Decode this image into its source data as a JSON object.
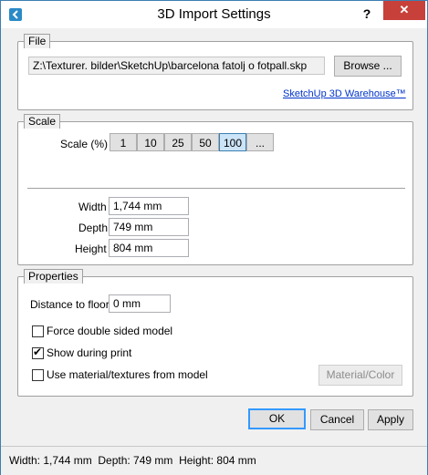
{
  "window": {
    "title": "3D Import Settings",
    "help_label": "?",
    "close_label": "✕"
  },
  "file_group": {
    "legend": "File",
    "path": "Z:\\Texturer. bilder\\SketchUp\\barcelona fatolj o fotpall.skp",
    "browse_label": "Browse ...",
    "warehouse_link": "SketchUp 3D Warehouse™"
  },
  "scale_group": {
    "legend": "Scale",
    "scale_label": "Scale (%)",
    "options": [
      "1",
      "10",
      "25",
      "50",
      "100",
      "..."
    ],
    "selected": "100",
    "width_label": "Width",
    "width_value": "1,744 mm",
    "depth_label": "Depth",
    "depth_value": "749 mm",
    "height_label": "Height",
    "height_value": "804 mm"
  },
  "properties_group": {
    "legend": "Properties",
    "distance_label": "Distance to floor",
    "distance_value": "0 mm",
    "force_double_label": "Force double sided model",
    "force_double_checked": false,
    "show_print_label": "Show during print",
    "show_print_checked": true,
    "use_material_label": "Use material/textures from model",
    "use_material_checked": false,
    "material_button_label": "Material/Color"
  },
  "buttons": {
    "ok": "OK",
    "cancel": "Cancel",
    "apply": "Apply"
  },
  "status": {
    "text": "Width: 1,744 mm  Depth: 749 mm  Height: 804 mm"
  },
  "colors": {
    "accent": "#3399ff",
    "close": "#c7413a",
    "link": "#0033cc"
  }
}
